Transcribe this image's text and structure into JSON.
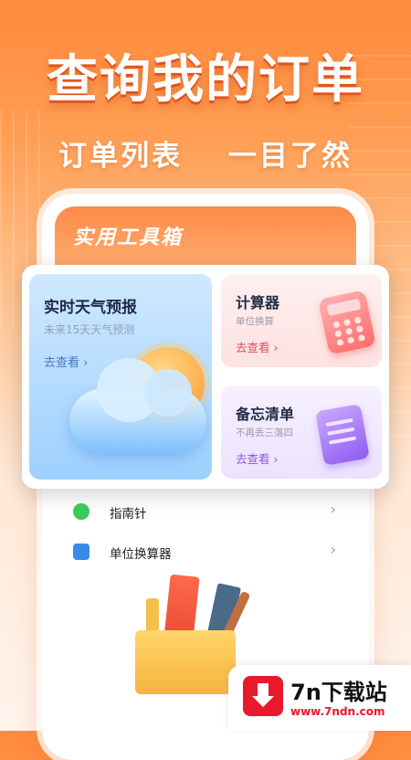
{
  "banner": {
    "headline": "查询我的订单",
    "subline_left": "订单列表",
    "subline_right": "一目了然"
  },
  "phone": {
    "section_title": "实用工具箱"
  },
  "tools": {
    "weather": {
      "title": "实时天气预报",
      "subtitle": "未来15天天气预测",
      "link": "去查看 ›"
    },
    "calculator": {
      "title": "计算器",
      "subtitle": "单位换算",
      "link": "去查看 ›"
    },
    "memo": {
      "title": "备忘清单",
      "subtitle": "不再丢三落四",
      "link": "去查看 ›"
    }
  },
  "list": [
    {
      "label": "指南针",
      "icon": "compass-icon",
      "color": "#3cc85a"
    },
    {
      "label": "单位换算器",
      "icon": "ruler-icon",
      "color": "#3a8be8"
    }
  ],
  "watermark": {
    "name": "7n下载站",
    "url": "www.7ndn.com"
  },
  "colors": {
    "brand_orange": "#ff8a3d",
    "link_blue": "#4a78c4",
    "calc_red": "#e04b5b",
    "memo_purple": "#8a5cd6"
  }
}
